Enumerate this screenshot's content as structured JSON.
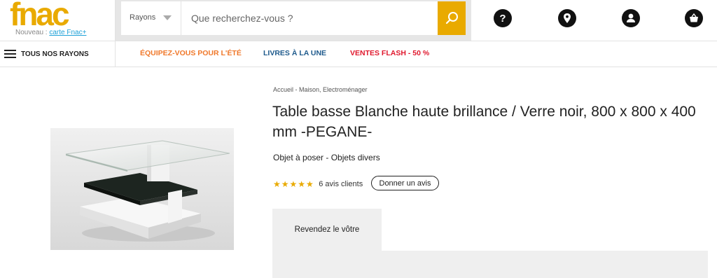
{
  "header": {
    "logo_text": "fnac",
    "logo_prefix": "Nouveau : ",
    "logo_link": "carte Fnac+",
    "brand_color": "#e9aa00",
    "rayons_label": "Rayons",
    "search_placeholder": "Que recherchez-vous ?",
    "icons": [
      "help-icon",
      "location-icon",
      "account-icon",
      "basket-icon"
    ]
  },
  "nav": {
    "all_label": "TOUS NOS RAYONS",
    "links": [
      {
        "label": "ÉQUIPEZ-VOUS POUR L'ÉTÉ",
        "color": "#f0782a"
      },
      {
        "label": "LIVRES À LA UNE",
        "color": "#1e5a8c"
      },
      {
        "label": "VENTES FLASH - 50 %",
        "color": "#e0182d"
      }
    ]
  },
  "product": {
    "breadcrumb": "Accueil - Maison, Electroménager",
    "title": "Table basse Blanche haute brillance / Verre noir, 800 x 800 x 400 mm -PEGANE-",
    "subtitle": "Objet à poser - Objets divers",
    "stars": "★★★★★",
    "rating": 5,
    "reviews_count": "6 avis clients",
    "review_button": "Donner un avis",
    "resell_tab": "Revendez le vôtre"
  }
}
